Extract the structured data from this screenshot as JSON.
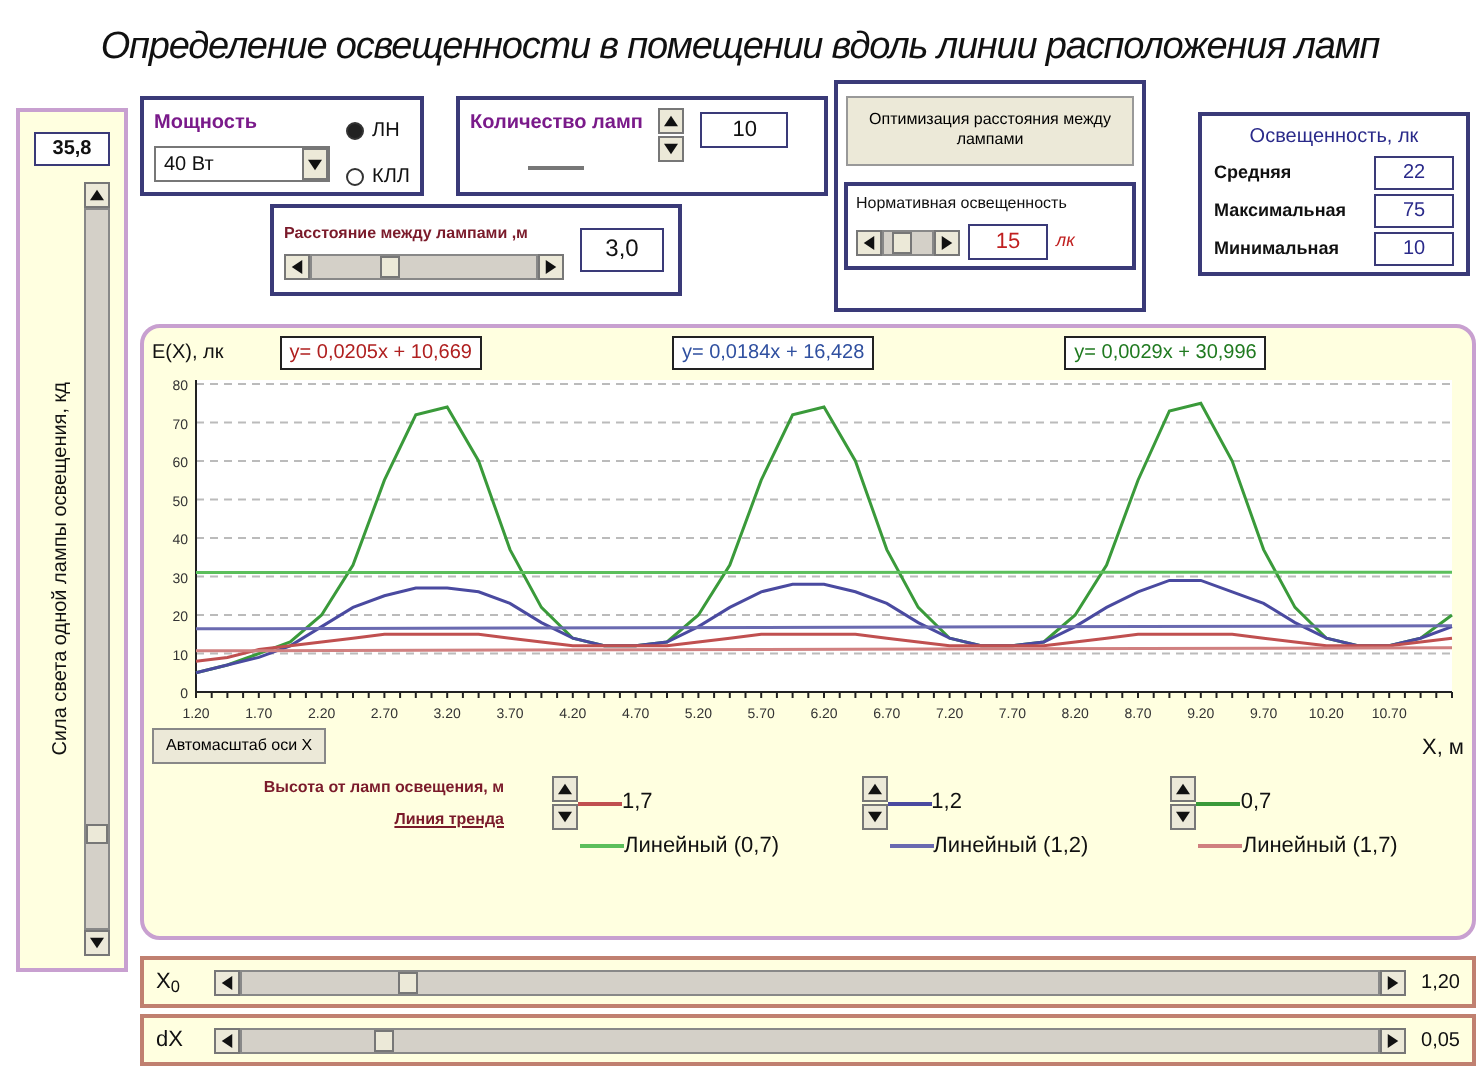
{
  "title": "Определение освещенности в помещении вдоль линии расположения ламп",
  "light_intensity": {
    "value": "35,8",
    "label": "Сила света одной лампы освещения, кд"
  },
  "power": {
    "label": "Мощность",
    "dropdown": "40 Вт",
    "options": [
      {
        "label": "ЛН",
        "selected": true
      },
      {
        "label": "КЛЛ",
        "selected": false
      }
    ]
  },
  "lamp_count": {
    "label": "Количество ламп",
    "value": "10"
  },
  "spacing": {
    "label": "Расстояние между лампами ,м",
    "value": "3,0"
  },
  "optimize_button": "Оптимизация расстояния между лампами",
  "norm": {
    "label": "Нормативная освещенность",
    "value": "15",
    "unit": "лк"
  },
  "illuminance": {
    "title": "Освещенность, лк",
    "rows": [
      {
        "label": "Средняя",
        "value": "22"
      },
      {
        "label": "Максимальная",
        "value": "75"
      },
      {
        "label": "Минимальная",
        "value": "10"
      }
    ]
  },
  "chart": {
    "y_title": "E(X), лк",
    "equations": [
      {
        "text": "y= 0,0205x + 10,669",
        "color": "#b02020"
      },
      {
        "text": "y= 0,0184x + 16,428",
        "color": "#3050a0"
      },
      {
        "text": "y= 0,0029x + 30,996",
        "color": "#207a20"
      }
    ],
    "autoscale_button": "Автомасштаб оси X",
    "x_title": "X, м",
    "height_label": "Высота от ламп освещения, м",
    "trend_label": "Линия тренда",
    "chart_data": {
      "type": "line",
      "grid": true,
      "x": [
        1.2,
        1.45,
        1.7,
        1.95,
        2.2,
        2.45,
        2.7,
        2.95,
        3.2,
        3.45,
        3.7,
        3.95,
        4.2,
        4.45,
        4.7,
        4.95,
        5.2,
        5.45,
        5.7,
        5.95,
        6.2,
        6.45,
        6.7,
        6.95,
        7.2,
        7.45,
        7.7,
        7.95,
        8.2,
        8.45,
        8.7,
        8.95,
        9.2,
        9.45,
        9.7,
        9.95,
        10.2,
        10.45,
        10.7,
        10.95,
        11.2
      ],
      "xlim": [
        1.2,
        11.2
      ],
      "ylim": [
        0,
        80
      ],
      "yticks": [
        0,
        10,
        20,
        30,
        40,
        50,
        60,
        70,
        80
      ],
      "xticks": [
        {
          "value": 1.2,
          "label": "1.20"
        },
        {
          "value": 1.7,
          "label": "1.70"
        },
        {
          "value": 2.2,
          "label": "2.20"
        },
        {
          "value": 2.7,
          "label": "2.70"
        },
        {
          "value": 3.2,
          "label": "3.20"
        },
        {
          "value": 3.7,
          "label": "3.70"
        },
        {
          "value": 4.2,
          "label": "4.20"
        },
        {
          "value": 4.7,
          "label": "4.70"
        },
        {
          "value": 5.2,
          "label": "5.20"
        },
        {
          "value": 5.7,
          "label": "5.70"
        },
        {
          "value": 6.2,
          "label": "6.20"
        },
        {
          "value": 6.7,
          "label": "6.70"
        },
        {
          "value": 7.2,
          "label": "7.20"
        },
        {
          "value": 7.7,
          "label": "7.70"
        },
        {
          "value": 8.2,
          "label": "8.20"
        },
        {
          "value": 8.7,
          "label": "8.70"
        },
        {
          "value": 9.2,
          "label": "9.20"
        },
        {
          "value": 9.7,
          "label": "9.70"
        },
        {
          "value": 10.2,
          "label": "10.20"
        },
        {
          "value": 10.7,
          "label": "10.70"
        }
      ],
      "series": [
        {
          "name": "0,7",
          "color": "#3a9a3a",
          "values": [
            5,
            7,
            10,
            13,
            20,
            33,
            55,
            72,
            74,
            60,
            37,
            22,
            14,
            12,
            12,
            13,
            20,
            33,
            55,
            72,
            74,
            60,
            37,
            22,
            14,
            12,
            12,
            13,
            20,
            33,
            55,
            73,
            75,
            60,
            37,
            22,
            14,
            12,
            12,
            14,
            20
          ]
        },
        {
          "name": "1,2",
          "color": "#4a4aa0",
          "values": [
            5,
            7,
            9,
            12,
            17,
            22,
            25,
            27,
            27,
            26,
            23,
            18,
            14,
            12,
            12,
            13,
            17,
            22,
            26,
            28,
            28,
            26,
            23,
            18,
            14,
            12,
            12,
            13,
            17,
            22,
            26,
            29,
            29,
            26,
            23,
            18,
            14,
            12,
            12,
            14,
            17
          ]
        },
        {
          "name": "1,7",
          "color": "#c05050",
          "values": [
            8,
            9,
            11,
            12,
            13,
            14,
            15,
            15,
            15,
            15,
            14,
            13,
            12,
            12,
            12,
            12,
            13,
            14,
            15,
            15,
            15,
            15,
            14,
            13,
            12,
            12,
            12,
            12,
            13,
            14,
            15,
            15,
            15,
            15,
            14,
            13,
            12,
            12,
            12,
            13,
            14
          ]
        },
        {
          "name": "Линейный (0,7)",
          "color": "#5cbf5c",
          "values": [
            31.0,
            null,
            null,
            null,
            null,
            null,
            null,
            null,
            null,
            null,
            null,
            null,
            null,
            null,
            null,
            null,
            null,
            null,
            null,
            null,
            null,
            null,
            null,
            null,
            null,
            null,
            null,
            null,
            null,
            null,
            null,
            null,
            null,
            null,
            null,
            null,
            null,
            null,
            null,
            null,
            31.1
          ]
        },
        {
          "name": "Линейный (1,2)",
          "color": "#6a6ab0",
          "values": [
            16.4,
            null,
            null,
            null,
            null,
            null,
            null,
            null,
            null,
            null,
            null,
            null,
            null,
            null,
            null,
            null,
            null,
            null,
            null,
            null,
            null,
            null,
            null,
            null,
            null,
            null,
            null,
            null,
            null,
            null,
            null,
            null,
            null,
            null,
            null,
            null,
            null,
            null,
            null,
            null,
            17.2
          ]
        },
        {
          "name": "Линейный (1,7)",
          "color": "#d08080",
          "values": [
            10.7,
            null,
            null,
            null,
            null,
            null,
            null,
            null,
            null,
            null,
            null,
            null,
            null,
            null,
            null,
            null,
            null,
            null,
            null,
            null,
            null,
            null,
            null,
            null,
            null,
            null,
            null,
            null,
            null,
            null,
            null,
            null,
            null,
            null,
            null,
            null,
            null,
            null,
            null,
            null,
            11.5
          ]
        }
      ]
    }
  },
  "x0": {
    "label": "X$_{0}$",
    "value": "1,20"
  },
  "dx": {
    "label": "dX",
    "value": "0,05"
  }
}
